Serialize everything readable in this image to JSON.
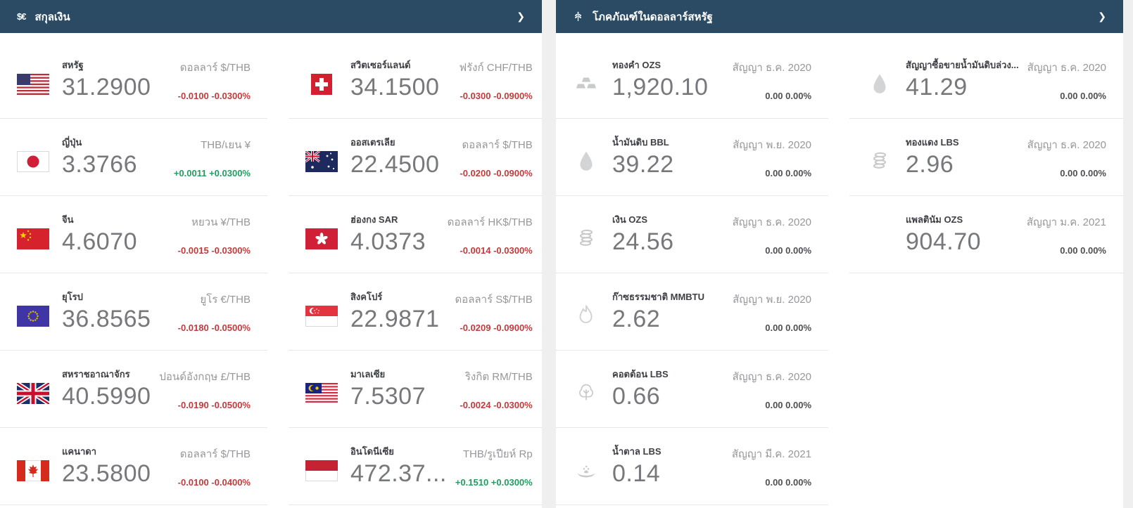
{
  "currencies": {
    "title": "สกุลเงิน",
    "icon_text": "$€",
    "chevron": "❯",
    "items": [
      {
        "country": "สหรัฐ",
        "flag": "us-flag",
        "price": "31.2900",
        "pair": "ดอลลาร์ $/THB",
        "change": "-0.0100 -0.0300%",
        "direction": "down"
      },
      {
        "country": "สวิตเซอร์แลนด์",
        "flag": "switzerland-flag",
        "price": "34.1500",
        "pair": "ฟรังก์ CHF/THB",
        "change": "-0.0300 -0.0900%",
        "direction": "down"
      },
      {
        "country": "ญี่ปุ่น",
        "flag": "japan-flag",
        "price": "3.3766",
        "pair": "THB/เยน ¥",
        "change": "+0.0011 +0.0300%",
        "direction": "up"
      },
      {
        "country": "ออสเตรเลีย",
        "flag": "australia-flag",
        "price": "22.4500",
        "pair": "ดอลลาร์ $/THB",
        "change": "-0.0200 -0.0900%",
        "direction": "down"
      },
      {
        "country": "จีน",
        "flag": "china-flag",
        "price": "4.6070",
        "pair": "หยวน ¥/THB",
        "change": "-0.0015 -0.0300%",
        "direction": "down"
      },
      {
        "country": "ฮ่องกง SAR",
        "flag": "hong-kong-flag",
        "price": "4.0373",
        "pair": "ดอลลาร์ HK$/THB",
        "change": "-0.0014 -0.0300%",
        "direction": "down"
      },
      {
        "country": "ยุโรป",
        "flag": "eu-flag",
        "price": "36.8565",
        "pair": "ยูโร €/THB",
        "change": "-0.0180 -0.0500%",
        "direction": "down"
      },
      {
        "country": "สิงคโปร์",
        "flag": "singapore-flag",
        "price": "22.9871",
        "pair": "ดอลลาร์ S$/THB",
        "change": "-0.0209 -0.0900%",
        "direction": "down"
      },
      {
        "country": "สหราชอาณาจักร",
        "flag": "uk-flag",
        "price": "40.5990",
        "pair": "ปอนด์อังกฤษ £/THB",
        "change": "-0.0190 -0.0500%",
        "direction": "down"
      },
      {
        "country": "มาเลเซีย",
        "flag": "malaysia-flag",
        "price": "7.5307",
        "pair": "ริงกิต RM/THB",
        "change": "-0.0024 -0.0300%",
        "direction": "down"
      },
      {
        "country": "แคนาดา",
        "flag": "canada-flag",
        "price": "23.5800",
        "pair": "ดอลลาร์ $/THB",
        "change": "-0.0100 -0.0400%",
        "direction": "down"
      },
      {
        "country": "อินโดนีเซีย",
        "flag": "indonesia-flag",
        "price": "472.37...",
        "pair": "THB/รูเปียห์ Rp",
        "change": "+0.1510 +0.0300%",
        "direction": "up"
      }
    ]
  },
  "commodities": {
    "title": "โภคภัณฑ์ในดอลลาร์สหรัฐ",
    "chevron": "❯",
    "items": [
      {
        "name": "ทองคำ OZS",
        "icon": "gold-bars-icon",
        "price": "1,920.10",
        "contract": "สัญญา ธ.ค. 2020",
        "change": "0.00 0.00%"
      },
      {
        "name": "สัญญาซื้อขายน้ำมันดิบล่วง...",
        "icon": "oil-drop-icon",
        "price": "41.29",
        "contract": "สัญญา ธ.ค. 2020",
        "change": "0.00 0.00%"
      },
      {
        "name": "น้ำมันดิบ BBL",
        "icon": "oil-drop-icon",
        "price": "39.22",
        "contract": "สัญญา พ.ย. 2020",
        "change": "0.00 0.00%"
      },
      {
        "name": "ทองแดง LBS",
        "icon": "coin-stack-icon",
        "price": "2.96",
        "contract": "สัญญา ธ.ค. 2020",
        "change": "0.00 0.00%"
      },
      {
        "name": "เงิน OZS",
        "icon": "coin-stack-icon",
        "price": "24.56",
        "contract": "สัญญา ธ.ค. 2020",
        "change": "0.00 0.00%"
      },
      {
        "name": "แพลตินัม OZS",
        "icon": "none",
        "price": "904.70",
        "contract": "สัญญา ม.ค. 2021",
        "change": "0.00 0.00%"
      },
      {
        "name": "ก๊าซธรรมชาติ MMBTU",
        "icon": "flame-icon",
        "price": "2.62",
        "contract": "สัญญา พ.ย. 2020",
        "change": "0.00 0.00%"
      },
      {
        "name": "คอตต้อน LBS",
        "icon": "cotton-icon",
        "price": "0.66",
        "contract": "สัญญา ธ.ค. 2020",
        "change": "0.00 0.00%"
      },
      {
        "name": "น้ำตาล LBS",
        "icon": "sugar-spoon-icon",
        "price": "0.14",
        "contract": "สัญญา มี.ค. 2021",
        "change": "0.00 0.00%"
      }
    ]
  },
  "colors": {
    "header_bg": "#2b4a63",
    "negative": "#c13b3c",
    "positive": "#239c61",
    "neutral": "#4e4f53",
    "price_text": "#77787c"
  }
}
